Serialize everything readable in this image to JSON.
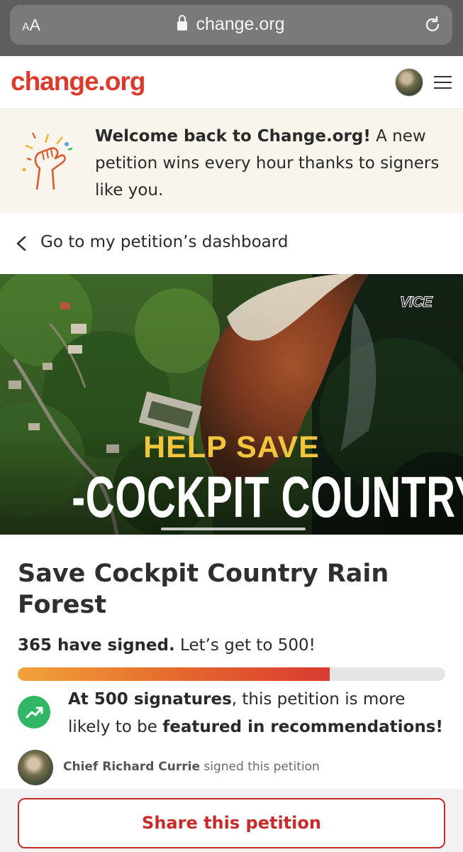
{
  "browser": {
    "text_size_label_small": "A",
    "text_size_label_large": "A",
    "url": "change.org",
    "lock_icon": "lock-icon",
    "reload_icon": "reload-icon"
  },
  "header": {
    "logo": "change.org",
    "menu_icon": "hamburger-menu-icon"
  },
  "welcome": {
    "bold": "Welcome back to Change.org!",
    "text": " A new petition wins every hour thanks to signers like you.",
    "icon": "raised-fist-celebration-icon"
  },
  "dashboard": {
    "label": "Go to my petition’s dashboard"
  },
  "hero": {
    "brand": "VICE",
    "line1": "HELP SAVE",
    "line2": "-COCKPIT COUNTRY-"
  },
  "petition": {
    "title": "Save Cockpit Country Rain Forest",
    "signed_bold": "365 have signed.",
    "signed_rest": " Let’s get to 500!",
    "signed_count": 365,
    "goal": 500,
    "milestone_bold1": "At 500 signatures",
    "milestone_mid": ", this petition is more likely to be ",
    "milestone_bold2": "featured in recommendations!",
    "milestone_icon": "trending-up-icon"
  },
  "recent_signer": {
    "name": "Chief Richard Currie",
    "action": " signed this petition"
  },
  "actions": {
    "share_label": "Share this petition"
  },
  "colors": {
    "brand_red": "#de3a2b",
    "progress_start": "#f2a33a",
    "progress_end": "#d93a32",
    "trend_green": "#30b665",
    "banner_bg": "#f8f5ec"
  }
}
